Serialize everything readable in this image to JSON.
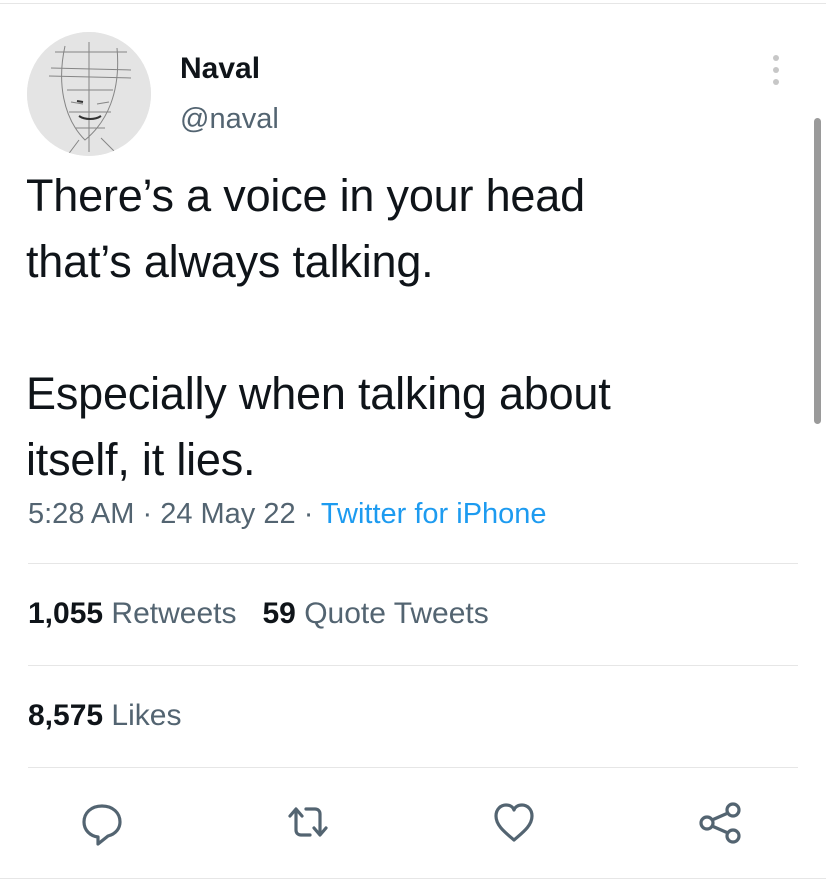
{
  "tweet": {
    "author": {
      "name": "Naval",
      "handle": "@naval"
    },
    "text_lines": [
      "There’s a voice in your head",
      "that’s always talking.",
      "",
      "Especially when talking about",
      "itself, it lies."
    ],
    "time": "5:28 AM",
    "date": "24 May 22",
    "separator": "·",
    "source": "Twitter for iPhone"
  },
  "stats": {
    "retweets_count": "1,055",
    "retweets_label": "Retweets",
    "quotes_count": "59",
    "quotes_label": "Quote Tweets",
    "likes_count": "8,575",
    "likes_label": "Likes"
  },
  "icons": {
    "more": "more-vertical-icon",
    "reply": "reply-icon",
    "retweet": "retweet-icon",
    "like": "heart-icon",
    "share": "share-icon"
  },
  "colors": {
    "link": "#1d9bf0",
    "secondary_text": "#536471",
    "primary_text": "#0f1419"
  }
}
